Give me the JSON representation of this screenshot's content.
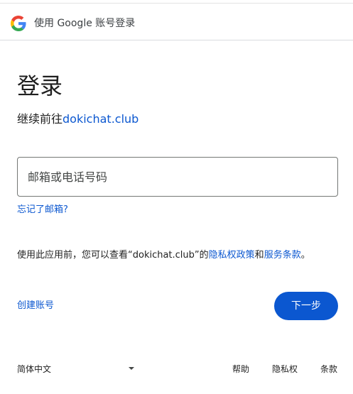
{
  "header": {
    "title": "使用 Google 账号登录",
    "logo_icon": "google-g-logo-icon"
  },
  "main": {
    "title": "登录",
    "subtitle_prefix": "继续前往",
    "subtitle_site": "dokichat.club",
    "email_placeholder": "邮箱或电话号码",
    "email_value": "",
    "forgot_email": "忘记了邮箱?",
    "notice_prefix": "使用此应用前，您可以查看“dokichat.club”的",
    "privacy_policy": "隐私权政策",
    "notice_and": "和",
    "terms_of_service": "服务条款",
    "notice_suffix": "。",
    "create_account": "创建账号",
    "next_button": "下一步"
  },
  "footer": {
    "language": "简体中文",
    "help": "帮助",
    "privacy": "隐私权",
    "terms": "条款"
  },
  "colors": {
    "accent": "#0b57d0",
    "text": "#1f1f1f",
    "border": "#747775"
  }
}
